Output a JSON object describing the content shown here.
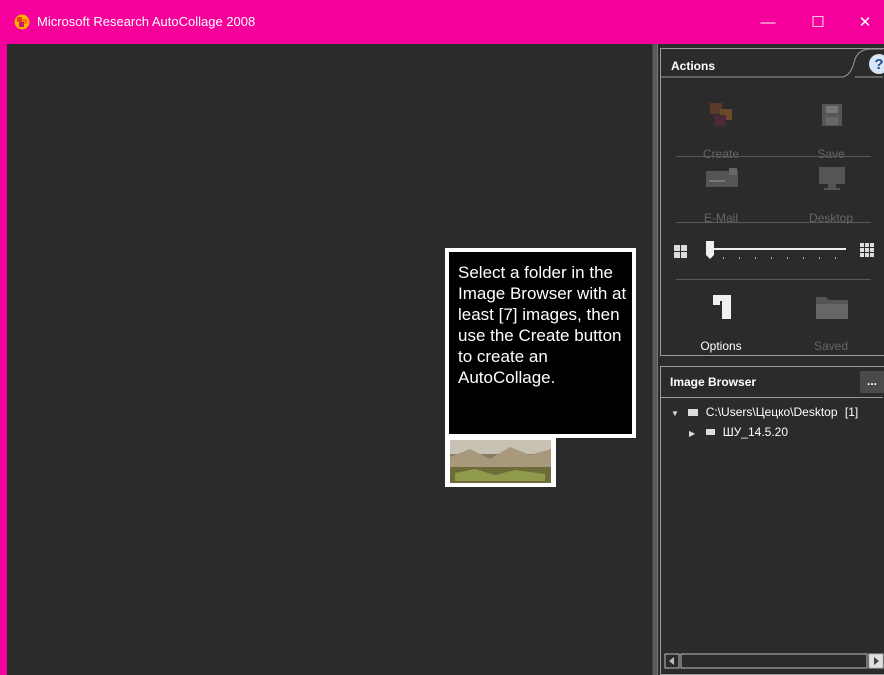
{
  "window": {
    "title": "Microsoft Research AutoCollage 2008",
    "minimize_glyph": "—",
    "maximize_glyph": "☐",
    "close_glyph": "✕"
  },
  "actions": {
    "title": "Actions",
    "help_glyph": "?",
    "create_label": "Create",
    "save_label": "Save",
    "email_label": "E-Mail",
    "desktop_label": "Desktop",
    "options_label": "Options",
    "saved_label": "Saved"
  },
  "image_browser": {
    "title": "Image Browser",
    "more_label": "...",
    "tree": [
      {
        "label": "C:\\Users\\Цецко\\Desktop",
        "count": "[1]",
        "expanded": true
      },
      {
        "label": "ШУ_14.5.20",
        "expanded": false
      }
    ]
  },
  "tooltip": {
    "text": "Select a folder in the Image Browser with at least [7] images, then use the Create button to create an AutoCollage."
  },
  "colors": {
    "accent": "#f5009a",
    "background": "#2b2b2b"
  },
  "icons": [
    "autocollage-app-icon",
    "create-icon",
    "save-icon",
    "email-icon",
    "desktop-icon",
    "options-icon",
    "saved-folder-icon",
    "help-icon",
    "folder-icon"
  ]
}
